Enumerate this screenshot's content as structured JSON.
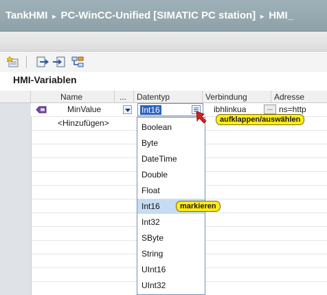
{
  "breadcrumb": {
    "items": [
      "TankHMI",
      "PC-WinCC-Unified [SIMATIC PC station]",
      "HMI_"
    ],
    "separator": "▸"
  },
  "section_title": "HMI-Variablen",
  "columns": {
    "name": "Name",
    "ellipsis": "...",
    "datatype": "Datentyp",
    "connection": "Verbindung",
    "address": "Adresse"
  },
  "rows": [
    {
      "name": "MinValue",
      "datatype": "Int16",
      "connection": "ibhlinkua",
      "address": "ns=http"
    },
    {
      "name": "<Hinzufügen>"
    }
  ],
  "row_button_label": "...",
  "datatype_options": [
    "Boolean",
    "Byte",
    "DateTime",
    "Double",
    "Float",
    "Int16",
    "Int32",
    "SByte",
    "String",
    "UInt16",
    "UInt32"
  ],
  "highlighted_option": "Int16",
  "callouts": {
    "expand": "aufklappen/auswählen",
    "mark": "markieren"
  },
  "colors": {
    "callout": "#ffec1a",
    "pointer": "#d42020",
    "selection": "#2b62c0",
    "title_bar": "#9fb1b8"
  }
}
